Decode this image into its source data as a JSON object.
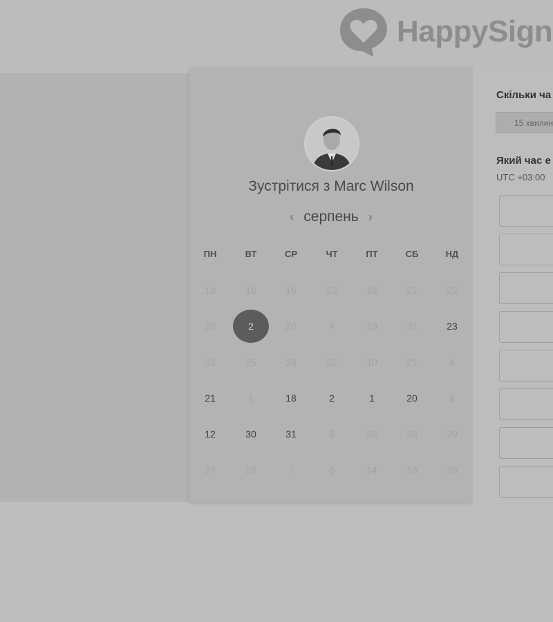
{
  "brand": {
    "logo_text": "HappySign"
  },
  "meeting": {
    "title": "Зустрітися з Marc Wilson"
  },
  "calendar": {
    "month": "серпень",
    "prev_icon": "chevron-left-icon",
    "next_icon": "chevron-right-icon",
    "weekdays": [
      "ПН",
      "ВТ",
      "СР",
      "ЧТ",
      "ПТ",
      "СБ",
      "НД"
    ],
    "weeks": [
      [
        {
          "d": "10",
          "s": "faded"
        },
        {
          "d": "18",
          "s": "faded"
        },
        {
          "d": "16",
          "s": "faded"
        },
        {
          "d": "23",
          "s": "faded"
        },
        {
          "d": "16",
          "s": "faded"
        },
        {
          "d": "21",
          "s": "faded"
        },
        {
          "d": "22",
          "s": "faded"
        }
      ],
      [
        {
          "d": "20",
          "s": "faded"
        },
        {
          "d": "2",
          "s": "selected"
        },
        {
          "d": "20",
          "s": "faded"
        },
        {
          "d": "4",
          "s": "faded"
        },
        {
          "d": "19",
          "s": "faded"
        },
        {
          "d": "31",
          "s": "faded"
        },
        {
          "d": "23",
          "s": "active"
        }
      ],
      [
        {
          "d": "31",
          "s": "faded"
        },
        {
          "d": "25",
          "s": "faded"
        },
        {
          "d": "28",
          "s": "faded"
        },
        {
          "d": "22",
          "s": "faded"
        },
        {
          "d": "10",
          "s": "faded"
        },
        {
          "d": "21",
          "s": "faded"
        },
        {
          "d": "4",
          "s": "faded"
        }
      ],
      [
        {
          "d": "21",
          "s": "active"
        },
        {
          "d": "1",
          "s": "faded"
        },
        {
          "d": "18",
          "s": "active"
        },
        {
          "d": "2",
          "s": "active"
        },
        {
          "d": "1",
          "s": "active"
        },
        {
          "d": "20",
          "s": "active"
        },
        {
          "d": "8",
          "s": "faded"
        }
      ],
      [
        {
          "d": "12",
          "s": "active"
        },
        {
          "d": "30",
          "s": "active"
        },
        {
          "d": "31",
          "s": "active"
        },
        {
          "d": "3",
          "s": "faded"
        },
        {
          "d": "26",
          "s": "faded"
        },
        {
          "d": "28",
          "s": "faded"
        },
        {
          "d": "20",
          "s": "faded"
        }
      ],
      [
        {
          "d": "27",
          "s": "faded"
        },
        {
          "d": "28",
          "s": "faded"
        },
        {
          "d": "7",
          "s": "faded"
        },
        {
          "d": "6",
          "s": "faded"
        },
        {
          "d": "14",
          "s": "faded"
        },
        {
          "d": "16",
          "s": "faded"
        },
        {
          "d": "25",
          "s": "faded"
        }
      ]
    ]
  },
  "booking": {
    "duration_question": "Скільки ча",
    "duration_option": "15 хвилин",
    "time_question": "Який час е",
    "timezone": "UTC +03:00",
    "slot_count": 8
  }
}
